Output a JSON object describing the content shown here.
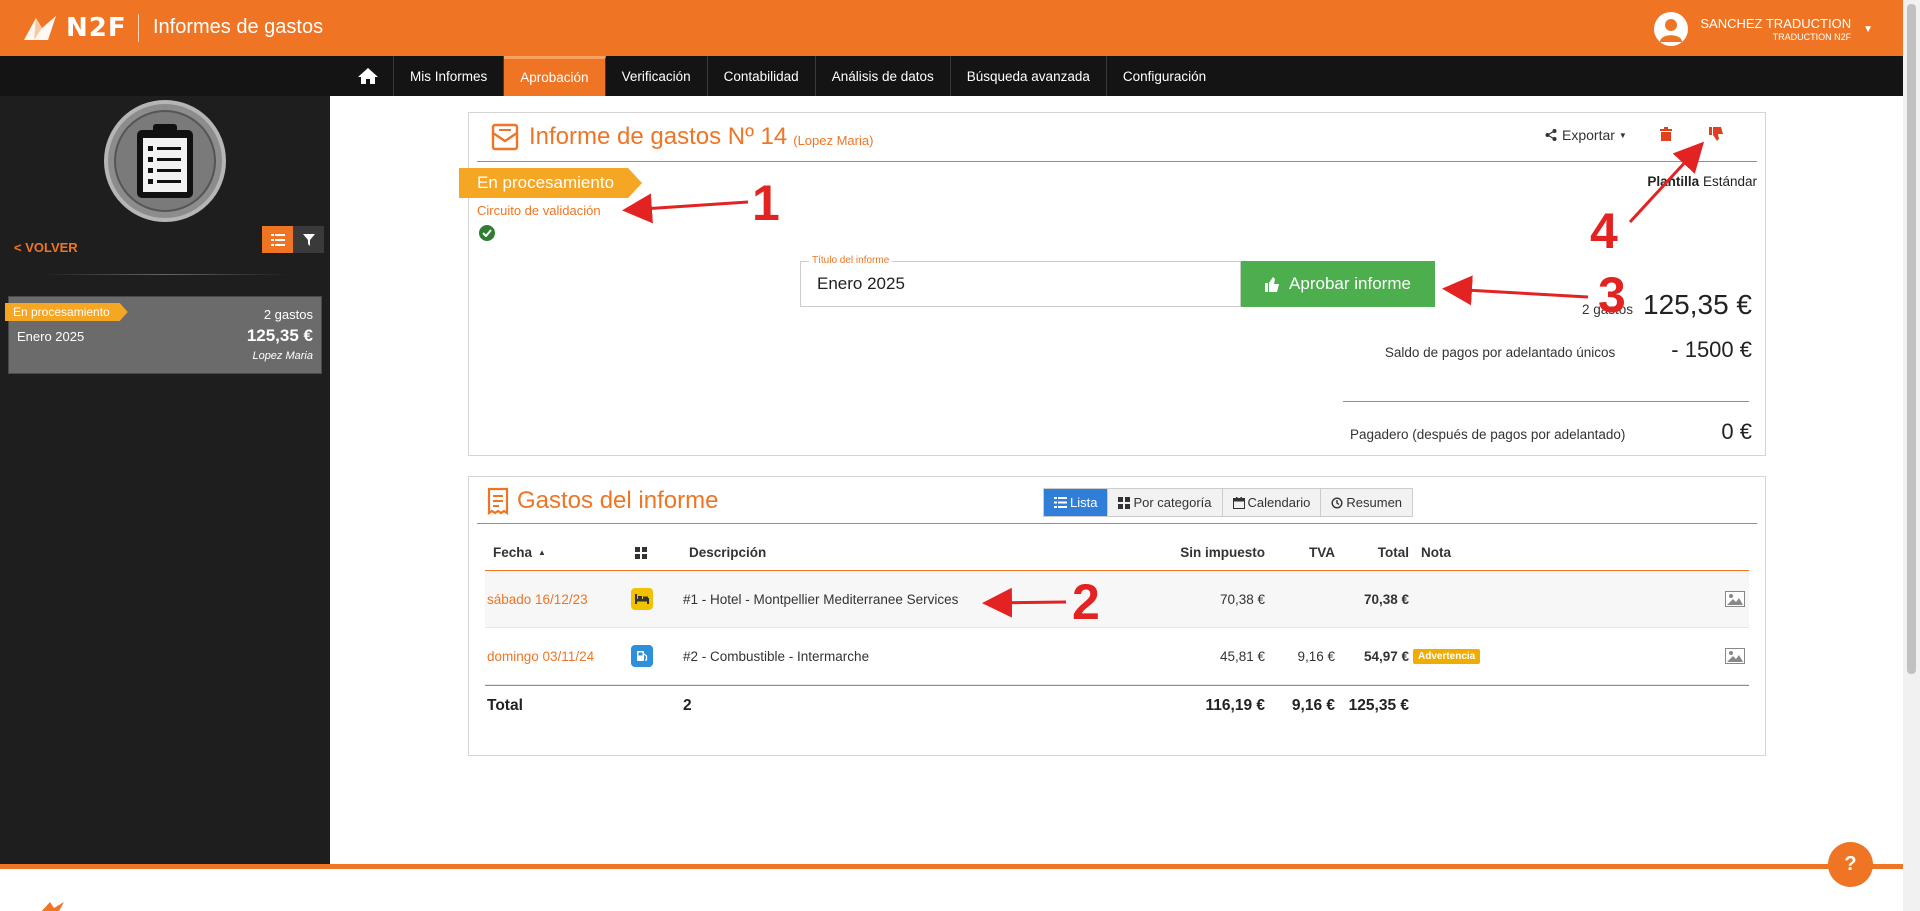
{
  "header": {
    "logo_text": "N2F",
    "app_title": "Informes de gastos",
    "user_name": "SANCHEZ TRADUCTION",
    "user_org": "TRADUCTION N2F",
    "brand_color": "#ef7524"
  },
  "nav": {
    "items": [
      "Mis Informes",
      "Aprobación",
      "Verificación",
      "Contabilidad",
      "Análisis de datos",
      "Búsqueda avanzada",
      "Configuración"
    ],
    "active": "Aprobación"
  },
  "sidebar": {
    "back_label": "< VOLVER",
    "card": {
      "status": "En procesamiento",
      "count": "2 gastos",
      "title": "Enero 2025",
      "amount": "125,35 €",
      "person": "Lopez Maria"
    }
  },
  "report": {
    "title": "Informe de gastos Nº  14",
    "owner": "(Lopez Maria)",
    "export_label": "Exportar",
    "status": "En procesamiento",
    "circuit_link": "Circuito de validación",
    "template_label": "Plantilla",
    "template_value": "Estándar",
    "title_field_label": "Título del informe",
    "title_field_value": "Enero 2025",
    "approve_label": "Aprobar informe",
    "count_label": "2 gastos",
    "total": "125,35 €",
    "advance_label": "Saldo de pagos por adelantado únicos",
    "advance_value": "- 1500 €",
    "payable_label": "Pagadero (después de pagos por adelantado)",
    "payable_value": "0 €"
  },
  "expenses": {
    "title": "Gastos del informe",
    "views": [
      "Lista",
      "Por categoría",
      "Calendario",
      "Resumen"
    ],
    "active_view": "Lista",
    "columns": {
      "date": "Fecha",
      "description": "Descripción",
      "net": "Sin impuesto",
      "tax": "TVA",
      "total": "Total",
      "note": "Nota"
    },
    "rows": [
      {
        "date": "sábado 16/12/23",
        "category_icon": "bed-icon",
        "category_color": "#f2c200",
        "description": "#1 - Hotel - Montpellier Mediterranee Services",
        "net": "70,38 €",
        "tax": "",
        "total": "70,38 €",
        "note": ""
      },
      {
        "date": "domingo 03/11/24",
        "category_icon": "fuel-icon",
        "category_color": "#2f8fd8",
        "description": "#2 - Combustible - Intermarche",
        "net": "45,81 €",
        "tax": "9,16 €",
        "total": "54,97 €",
        "note": "Advertencia"
      }
    ],
    "totals": {
      "label": "Total",
      "count": "2",
      "net": "116,19 €",
      "tax": "9,16 €",
      "total": "125,35 €"
    }
  },
  "annotations": {
    "n1": "1",
    "n2": "2",
    "n3": "3",
    "n4": "4"
  },
  "help_label": "?"
}
